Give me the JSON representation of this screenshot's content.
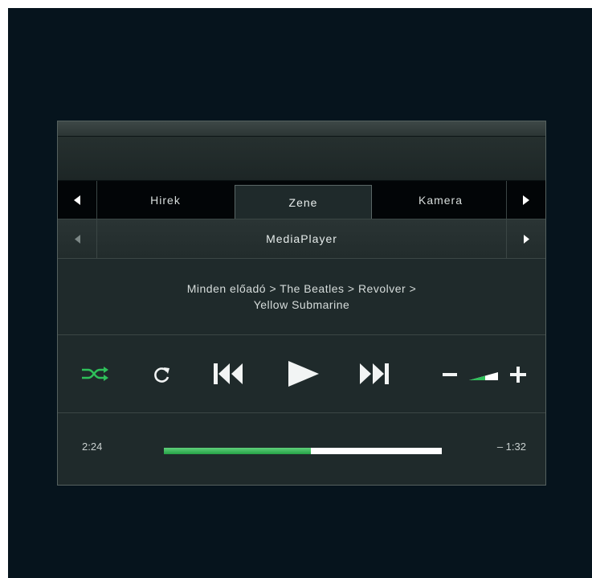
{
  "tabs": {
    "items": [
      "Hirek",
      "Zene",
      "Kamera"
    ],
    "active": "Zene"
  },
  "subnav": {
    "title": "MediaPlayer"
  },
  "breadcrumb": {
    "line1": "Minden előadó > The Beatles > Revolver >",
    "line2": "Yellow Submarine"
  },
  "controls": {
    "icons": [
      "shuffle-icon",
      "repeat-icon",
      "skip-previous-icon",
      "play-icon",
      "skip-next-icon",
      "volume-down-icon",
      "volume-level-icon",
      "volume-up-icon"
    ],
    "shuffle_active": true,
    "accent_color": "#2fbf5a"
  },
  "playback": {
    "elapsed": "2:24",
    "remaining": "– 1:32",
    "progress_fraction": 0.53
  }
}
